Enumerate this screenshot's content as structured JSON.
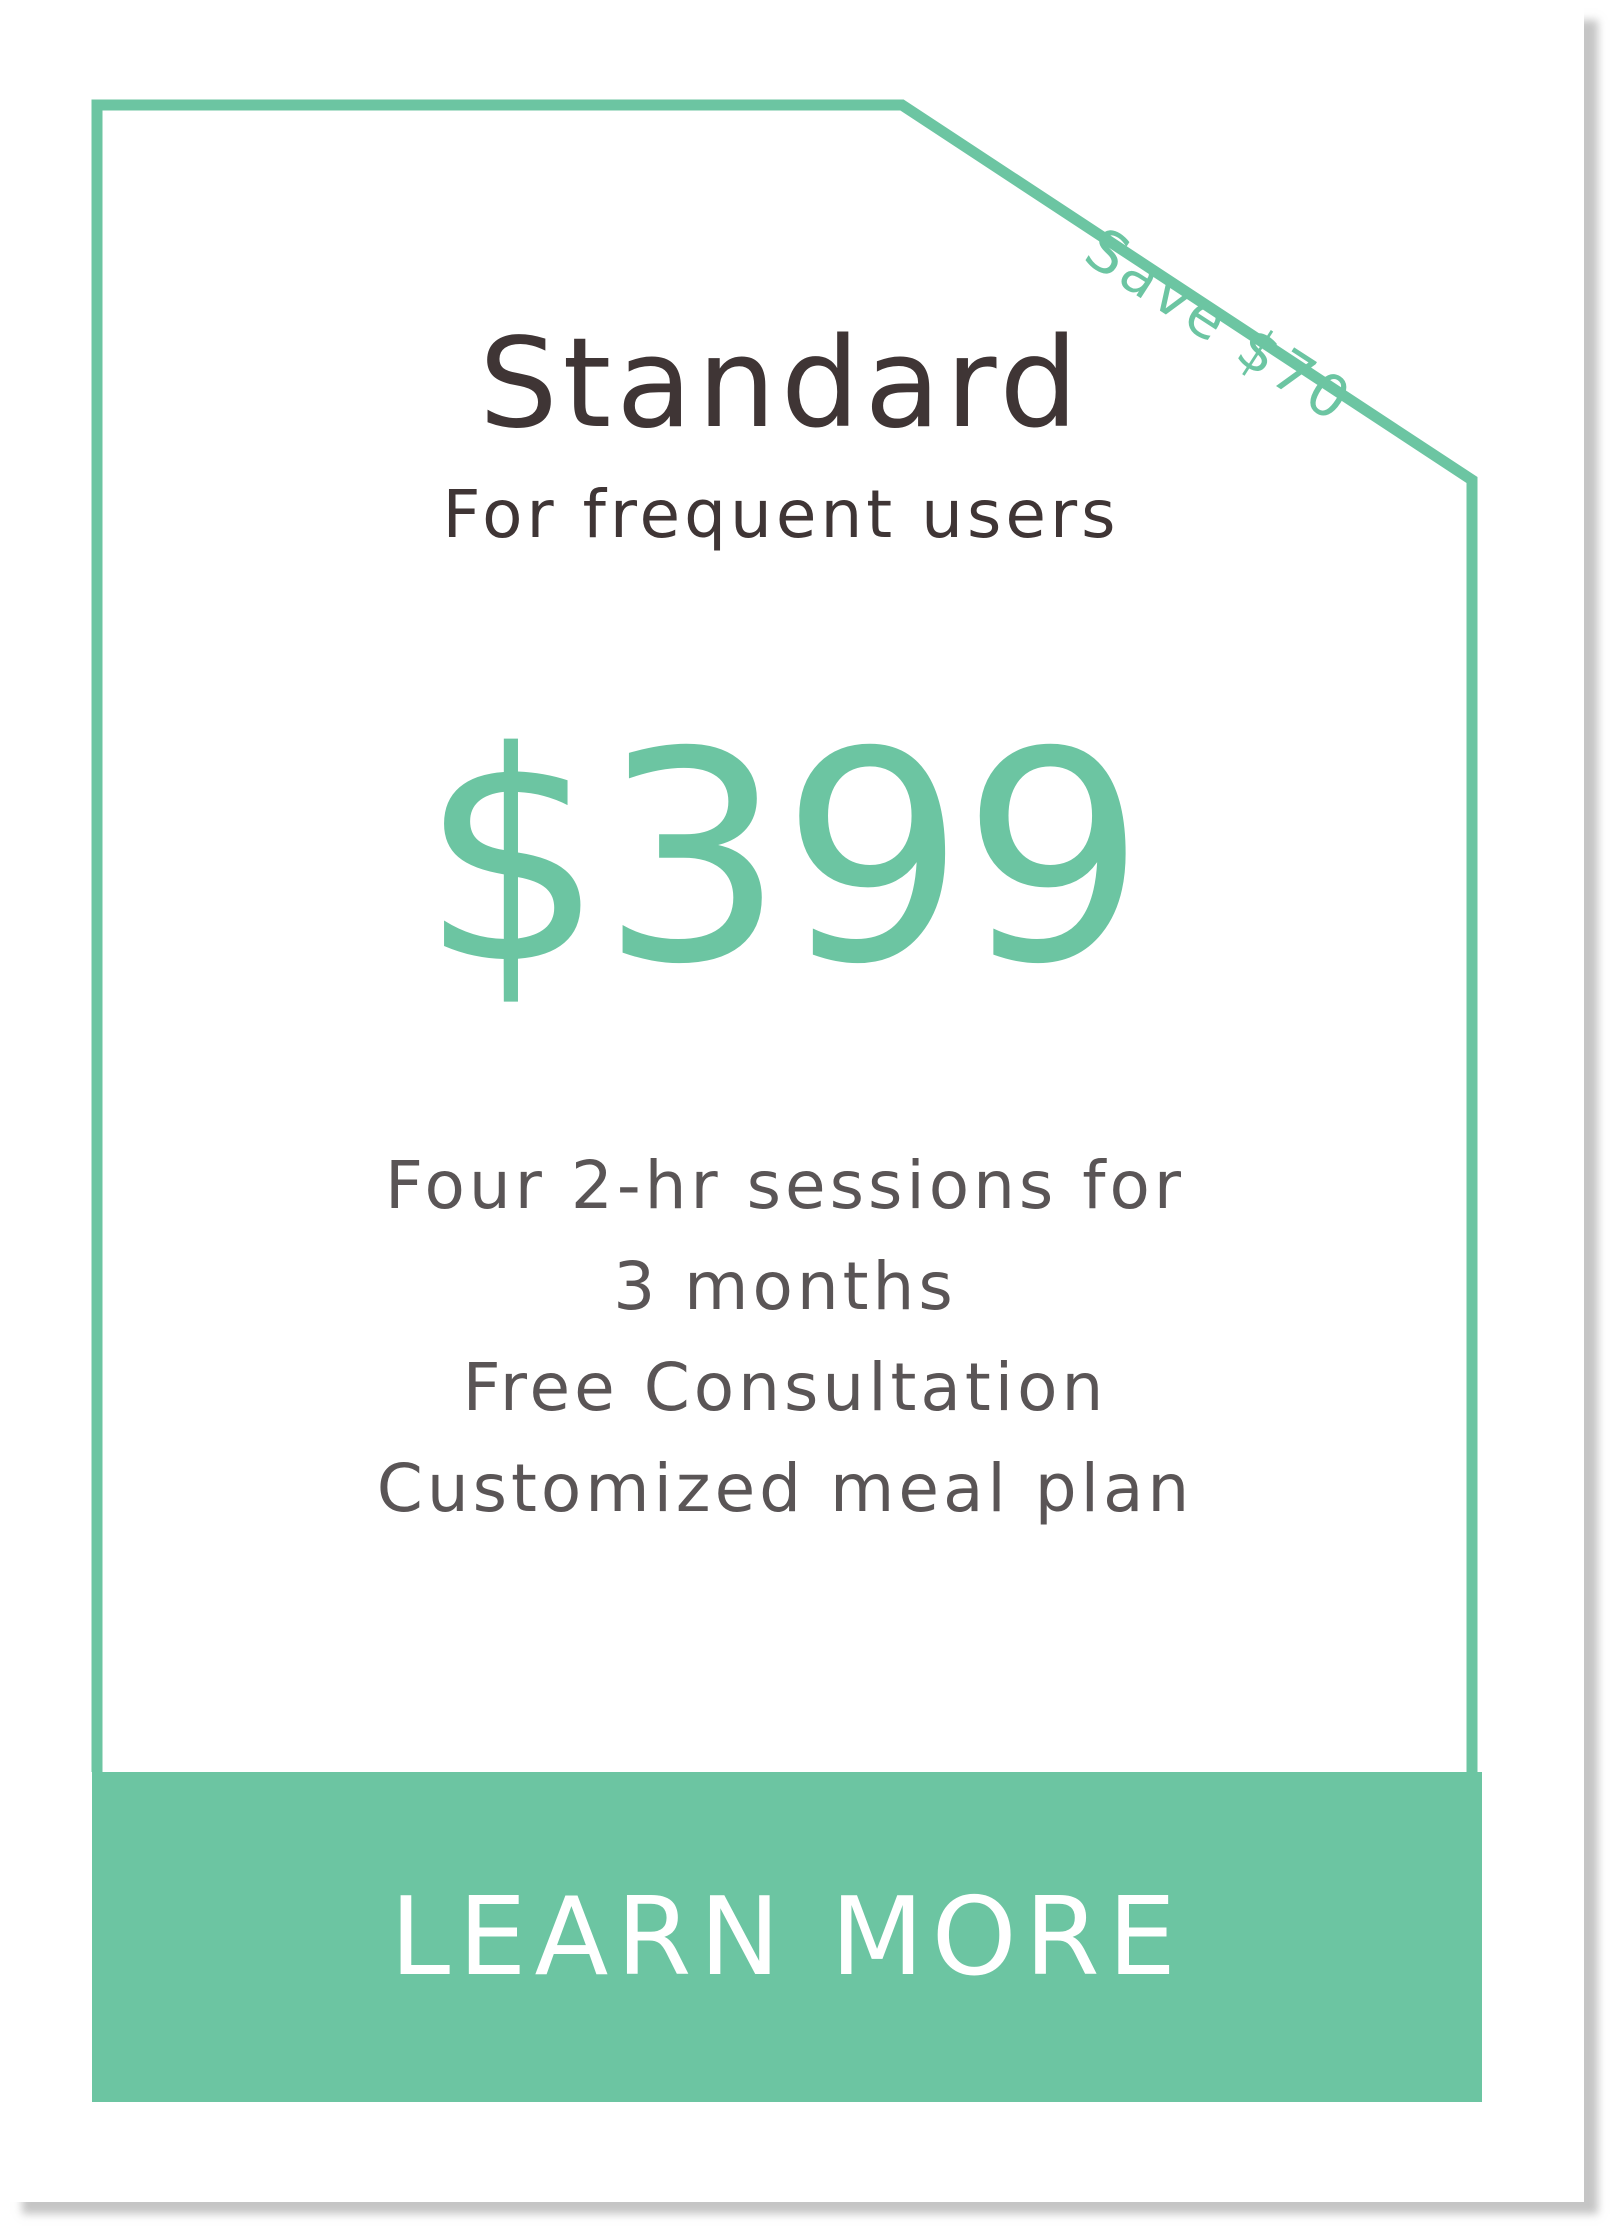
{
  "colors": {
    "accent": "#6cc5a2",
    "title_text": "#3f3535",
    "body_text": "#5a5556",
    "button_text": "#ffffff"
  },
  "badge": {
    "text": "Save $70"
  },
  "plan": {
    "name": "Standard",
    "tagline": "For frequent users",
    "price": "$399"
  },
  "features": [
    "Four 2-hr sessions for",
    "3 months",
    "Free Consultation",
    "Customized meal plan"
  ],
  "cta": {
    "label": "LEARN MORE"
  }
}
